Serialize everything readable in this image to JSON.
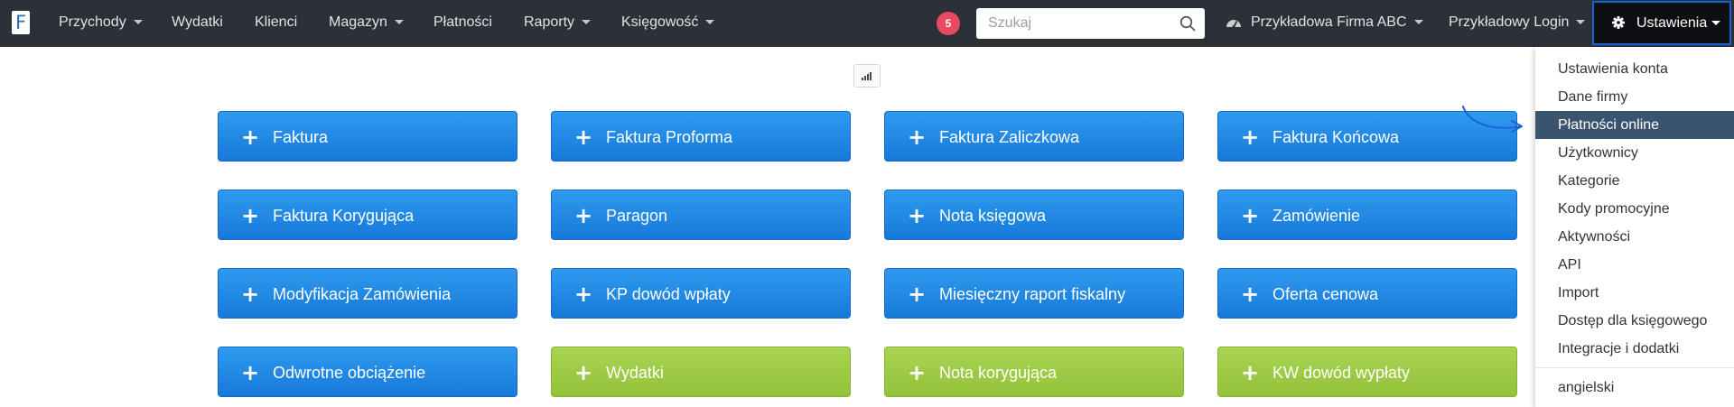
{
  "navbar": {
    "logo_letter": "F",
    "items": [
      {
        "label": "Przychody",
        "has_caret": true
      },
      {
        "label": "Wydatki",
        "has_caret": false
      },
      {
        "label": "Klienci",
        "has_caret": false
      },
      {
        "label": "Magazyn",
        "has_caret": true
      },
      {
        "label": "Płatności",
        "has_caret": false
      },
      {
        "label": "Raporty",
        "has_caret": true
      },
      {
        "label": "Księgowość",
        "has_caret": true
      }
    ],
    "notification_count": "5",
    "search_placeholder": "Szukaj",
    "company": "Przykładowa Firma ABC",
    "login": "Przykładowy Login",
    "settings": "Ustawienia"
  },
  "tiles": [
    {
      "label": "Faktura",
      "color": "blue"
    },
    {
      "label": "Faktura Proforma",
      "color": "blue"
    },
    {
      "label": "Faktura Zaliczkowa",
      "color": "blue"
    },
    {
      "label": "Faktura Końcowa",
      "color": "blue"
    },
    {
      "label": "Faktura Korygująca",
      "color": "blue"
    },
    {
      "label": "Paragon",
      "color": "blue"
    },
    {
      "label": "Nota księgowa",
      "color": "blue"
    },
    {
      "label": "Zamówienie",
      "color": "blue"
    },
    {
      "label": "Modyfikacja Zamówienia",
      "color": "blue"
    },
    {
      "label": "KP dowód wpłaty",
      "color": "blue"
    },
    {
      "label": "Miesięczny raport fiskalny",
      "color": "blue"
    },
    {
      "label": "Oferta cenowa",
      "color": "blue"
    },
    {
      "label": "Odwrotne obciążenie",
      "color": "blue"
    },
    {
      "label": "Wydatki",
      "color": "green"
    },
    {
      "label": "Nota korygująca",
      "color": "green"
    },
    {
      "label": "KW dowód wypłaty",
      "color": "green"
    }
  ],
  "settings_menu": {
    "items": [
      {
        "label": "Ustawienia konta",
        "active": false
      },
      {
        "label": "Dane firmy",
        "active": false
      },
      {
        "label": "Płatności online",
        "active": true
      },
      {
        "label": "Użytkownicy",
        "active": false
      },
      {
        "label": "Kategorie",
        "active": false
      },
      {
        "label": "Kody promocyjne",
        "active": false
      },
      {
        "label": "Aktywności",
        "active": false
      },
      {
        "label": "API",
        "active": false
      },
      {
        "label": "Import",
        "active": false
      },
      {
        "label": "Dostęp dla księgowego",
        "active": false
      },
      {
        "label": "Integracje i dodatki",
        "active": false
      }
    ],
    "language": "angielski"
  },
  "colors": {
    "navbar_bg": "#2c3037",
    "tile_blue": "#1e88e5",
    "tile_green": "#9ccc45",
    "menu_active": "#3a5470",
    "settings_border": "#1c62d6",
    "badge": "#e84a5f",
    "annotation_arrow": "#1c62d6"
  },
  "icons": {
    "search": "magnifier-icon",
    "company": "dashboard-gauge-icon",
    "settings": "gear-icon",
    "chart": "signal-bars-icon",
    "tile": "plus-icon"
  }
}
